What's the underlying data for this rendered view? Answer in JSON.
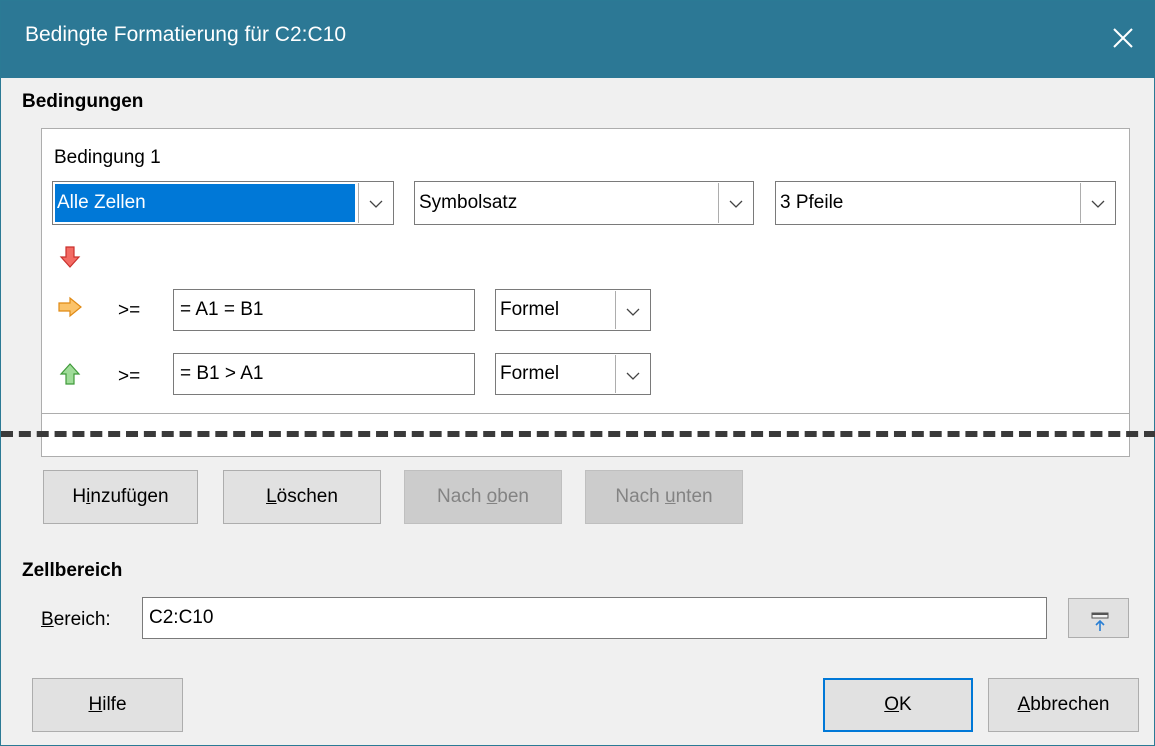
{
  "window": {
    "title": "Bedingte Formatierung für C2:C10",
    "close_label": "Schließen"
  },
  "conditions_section": {
    "heading": "Bedingungen",
    "condition": {
      "title": "Bedingung 1",
      "type_value": "Alle Zellen",
      "style_value": "Symbolsatz",
      "iconset_value": "3 Pfeile",
      "rows": [
        {
          "icon": "arrow-down-red-icon"
        },
        {
          "icon": "arrow-right-orange-icon",
          "operator": ">=",
          "value": "= A1 = B1",
          "kind": "Formel"
        },
        {
          "icon": "arrow-up-green-icon",
          "operator": ">=",
          "value": "= B1 > A1",
          "kind": "Formel"
        }
      ]
    },
    "buttons": {
      "add": {
        "pre": "H",
        "u": "i",
        "post": "nzufügen"
      },
      "delete": {
        "pre": "",
        "u": "L",
        "post": "öschen"
      },
      "up": {
        "pre": "Nach ",
        "u": "o",
        "post": "ben"
      },
      "down": {
        "pre": "Nach ",
        "u": "u",
        "post": "nten"
      }
    }
  },
  "range_section": {
    "heading": "Zellbereich",
    "label": {
      "pre": "",
      "u": "B",
      "post": "ereich:"
    },
    "value": "C2:C10"
  },
  "footer": {
    "help": {
      "pre": "",
      "u": "H",
      "post": "ilfe"
    },
    "ok": {
      "pre": "",
      "u": "O",
      "post": "K"
    },
    "cancel": {
      "pre": "",
      "u": "A",
      "post": "bbrechen"
    }
  },
  "colors": {
    "titlebar": "#2c7895",
    "selection": "#0078d7",
    "arrow_red": "#e8453c",
    "arrow_orange": "#f5a623",
    "arrow_green": "#7cc576"
  }
}
